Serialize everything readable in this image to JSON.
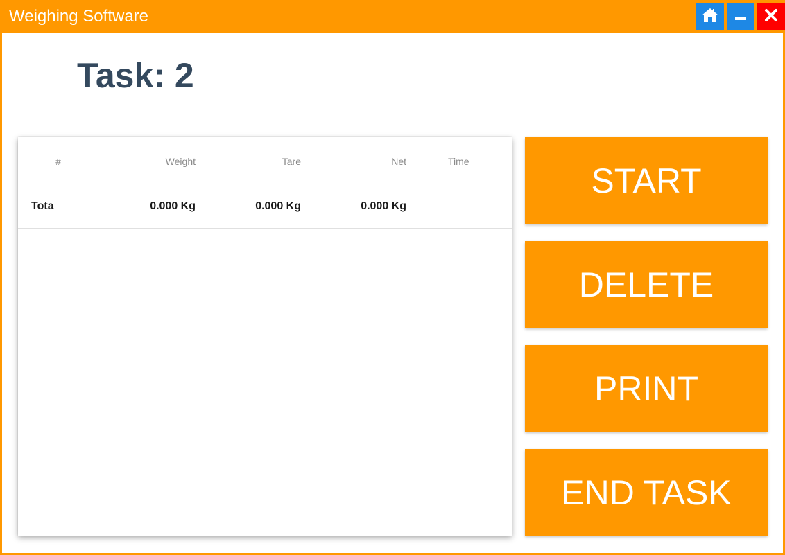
{
  "window": {
    "title": "Weighing Software",
    "controls": [
      "home-icon",
      "minimize-icon",
      "close-icon"
    ],
    "colors": {
      "titlebar": "#ff9800",
      "home": "#1e88e5",
      "minimize": "#1e88e5",
      "close": "#ff0000"
    }
  },
  "task": {
    "label": "Task:",
    "number": "2"
  },
  "table": {
    "headers": [
      "#",
      "Weight",
      "Tare",
      "Net",
      "Time"
    ],
    "total_row": {
      "label": "Tota",
      "weight": "0.000 Kg",
      "tare": "0.000 Kg",
      "net": "0.000 Kg",
      "time": ""
    }
  },
  "actions": {
    "start": "START",
    "delete": "DELETE",
    "print": "PRINT",
    "end_task": "END TASK",
    "color": "#ff9800"
  }
}
